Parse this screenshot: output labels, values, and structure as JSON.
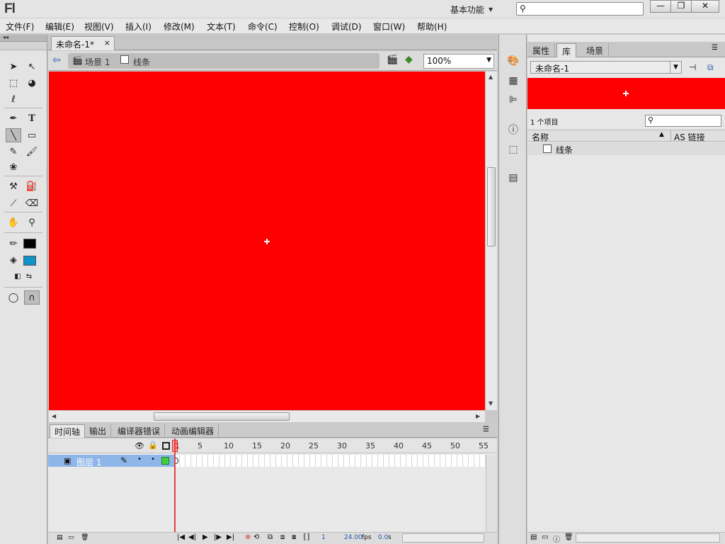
{
  "app": {
    "logo": "Fl",
    "workspace": "基本功能"
  },
  "window_controls": {
    "minimize": "—",
    "restore": "❐",
    "close": "✕"
  },
  "menus": [
    "文件(F)",
    "编辑(E)",
    "视图(V)",
    "插入(I)",
    "修改(M)",
    "文本(T)",
    "命令(C)",
    "控制(O)",
    "调试(D)",
    "窗口(W)",
    "帮助(H)"
  ],
  "document": {
    "tab_title": "未命名-1*",
    "close": "×"
  },
  "breadcrumb": {
    "scene": "场景 1",
    "symbol": "线条"
  },
  "zoom": "100%",
  "colors": {
    "stage": "#ff0000",
    "stroke": "#000000",
    "fill": "#0d92c9",
    "layer_selected": "#8fb6e8"
  },
  "timeline": {
    "tabs": [
      "时间轴",
      "输出",
      "编译器错误",
      "动画编辑器"
    ],
    "frame_numbers": [
      "1",
      "5",
      "10",
      "15",
      "20",
      "25",
      "30",
      "35",
      "40",
      "45",
      "50",
      "55"
    ],
    "layer_name": "图层 1",
    "current_frame": "1",
    "fps": "24.00",
    "fps_unit": "fps",
    "time": "0.0",
    "time_unit": "s"
  },
  "library": {
    "tabs": [
      "属性",
      "库",
      "场景"
    ],
    "document": "未命名-1",
    "item_count": "1 个项目",
    "col_name": "名称",
    "col_linkage": "AS 链接",
    "items": [
      "线条"
    ]
  }
}
